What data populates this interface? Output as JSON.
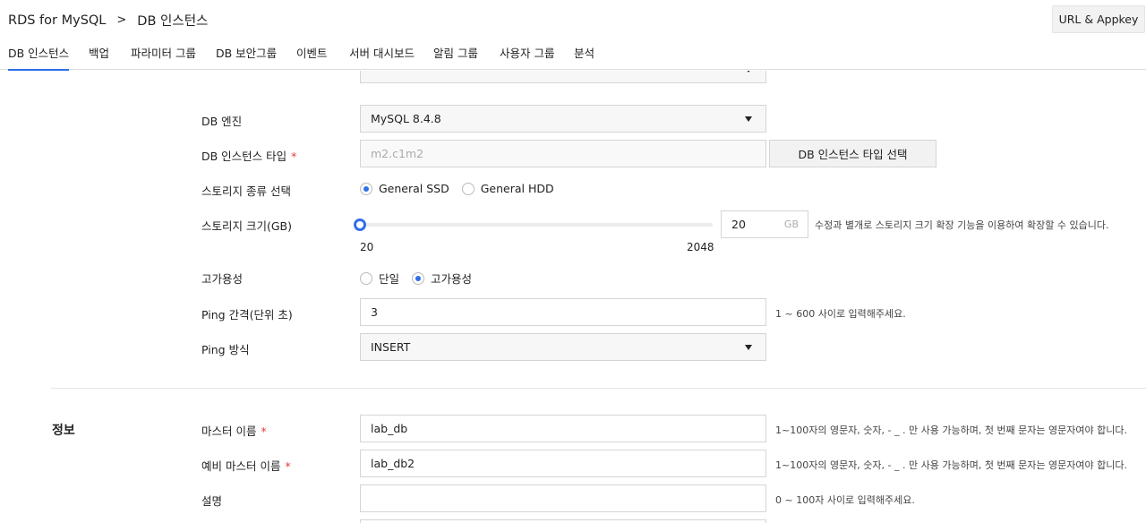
{
  "header": {
    "breadcrumb": [
      "RDS for MySQL",
      "DB 인스턴스"
    ],
    "breadcrumb_separator": ">",
    "url_appkey_button": "URL & Appkey"
  },
  "tabs": [
    "DB 인스턴스",
    "백업",
    "파라미터 그룹",
    "DB 보안그룹",
    "이벤트",
    "서버 대시보드",
    "알림 그룹",
    "사용자 그룹",
    "분석"
  ],
  "active_tab_index": 0,
  "spec_section": {
    "db_engine": {
      "label": "DB 엔진",
      "value": "MySQL 8.4.8"
    },
    "instance_type": {
      "label": "DB 인스턴스 타입",
      "placeholder": "m2.c1m2",
      "button": "DB 인스턴스 타입 선택"
    },
    "storage_type": {
      "label": "스토리지 종류 선택",
      "options": [
        "General SSD",
        "General HDD"
      ],
      "selected_index": 0
    },
    "storage_size": {
      "label": "스토리지 크기(GB)",
      "min": "20",
      "max": "2048",
      "value": "20",
      "unit": "GB",
      "hint": "수정과 별개로 스토리지 크기 확장 기능을 이용하여 확장할 수 있습니다."
    },
    "availability": {
      "label": "고가용성",
      "options": [
        "단일",
        "고가용성"
      ],
      "selected_index": 1
    },
    "ping_interval": {
      "label": "Ping 간격(단위 초)",
      "value": "3",
      "hint": "1 ~ 600 사이로 입력해주세요."
    },
    "ping_method": {
      "label": "Ping 방식",
      "value": "INSERT"
    }
  },
  "info_section": {
    "title": "정보",
    "master_name": {
      "label": "마스터 이름",
      "value": "lab_db",
      "hint": "1~100자의 영문자, 숫자, - _ . 만 사용 가능하며, 첫 번째 문자는 영문자여야 합니다."
    },
    "standby_name": {
      "label": "예비 마스터 이름",
      "value": "lab_db2",
      "hint": "1~100자의 영문자, 숫자, - _ . 만 사용 가능하며, 첫 번째 문자는 영문자여야 합니다."
    },
    "description": {
      "label": "설명",
      "value": "",
      "hint": "0 ~ 100자 사이로 입력해주세요."
    }
  },
  "colors": {
    "accent": "#2f6fe8",
    "required": "#e03c3c",
    "border": "#d5d5d5"
  }
}
